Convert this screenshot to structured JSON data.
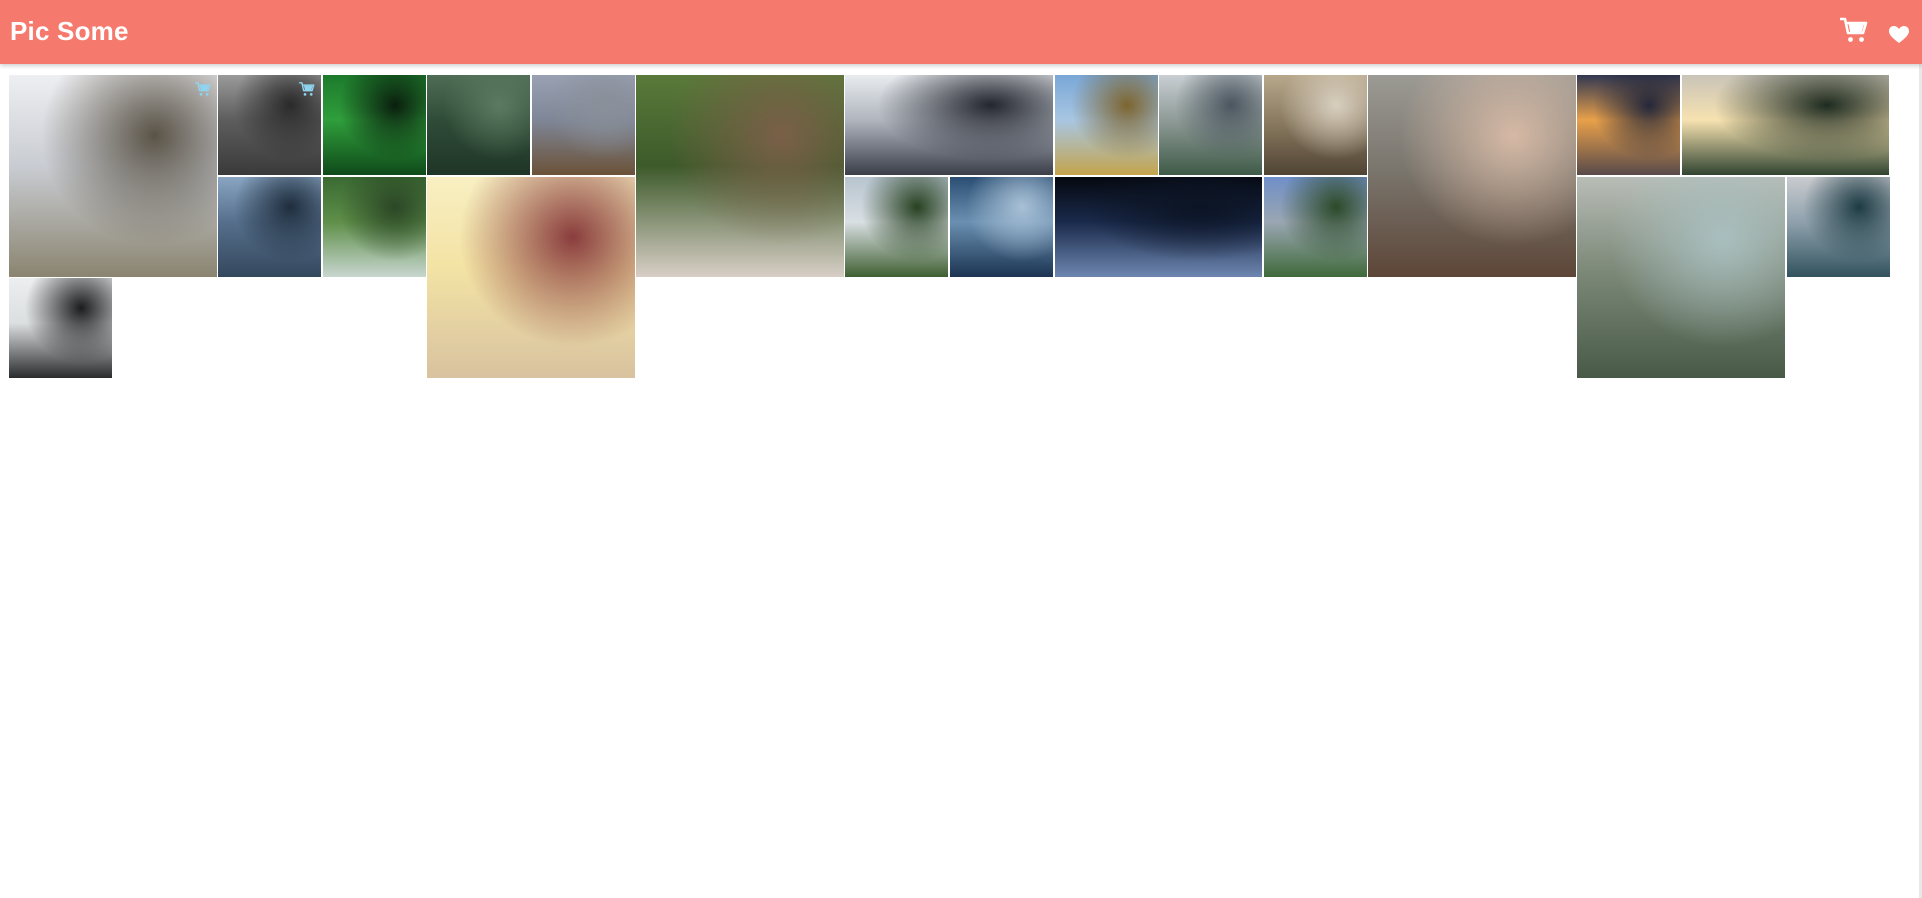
{
  "app": {
    "title": "Pic Some"
  },
  "header": {
    "icons": [
      {
        "name": "cart-icon",
        "color": "#ffffff"
      },
      {
        "name": "heart-icon",
        "color": "#ffffff"
      }
    ]
  },
  "colors": {
    "header_bg": "#f5796d",
    "accent_icon": "#8fd3ee",
    "page_bg": "#ffffff"
  },
  "photos": [
    {
      "id": "bear",
      "colors": [
        "#eeeff2",
        "#c9ccd2",
        "#8a8470",
        "#5a5347"
      ],
      "hover_icon": "cart-icon"
    },
    {
      "id": "foggy-forest",
      "colors": [
        "#9a9a9a",
        "#5d5d5d",
        "#3a3a3a",
        "#2a2a2a"
      ],
      "hover_icon": "cart-icon"
    },
    {
      "id": "aurora",
      "colors": [
        "#1d7a2c",
        "#2f9e3b",
        "#0f4a1a",
        "#0a1f0e"
      ]
    },
    {
      "id": "grass-figure",
      "colors": [
        "#4f6d55",
        "#2f4c38",
        "#1f3527",
        "#5b7a60"
      ]
    },
    {
      "id": "eagle",
      "colors": [
        "#9aa1b3",
        "#7e8697",
        "#6b5238",
        "#8a9099"
      ]
    },
    {
      "id": "pug-blanket",
      "colors": [
        "#5a7a3a",
        "#3d5a2a",
        "#d8cfc7",
        "#7a5f48"
      ]
    },
    {
      "id": "skyscraper",
      "colors": [
        "#e8ecef",
        "#b0b5be",
        "#3a3e49",
        "#23262f"
      ]
    },
    {
      "id": "feet-field",
      "colors": [
        "#79a7d7",
        "#a8c6e2",
        "#c4a44c",
        "#7d6530"
      ]
    },
    {
      "id": "city-park",
      "colors": [
        "#c9cfd3",
        "#8f9b97",
        "#3e5a47",
        "#4b5660"
      ]
    },
    {
      "id": "desert-trees",
      "colors": [
        "#b7a78b",
        "#8c7c62",
        "#4f4333",
        "#d8cfbf"
      ]
    },
    {
      "id": "woman-portrait",
      "colors": [
        "#9c9a94",
        "#7b776f",
        "#5d4638",
        "#d6b9a5"
      ]
    },
    {
      "id": "highway-sunset",
      "colors": [
        "#313852",
        "#e8a04a",
        "#584a4a",
        "#25283a"
      ]
    },
    {
      "id": "pine-sun",
      "colors": [
        "#c9c4b8",
        "#f6e2b0",
        "#314431",
        "#1e2b20"
      ]
    },
    {
      "id": "seascape",
      "colors": [
        "#89a5c2",
        "#566f8c",
        "#34485d",
        "#1f2e3e"
      ]
    },
    {
      "id": "waterfall",
      "colors": [
        "#3a6a32",
        "#5f8f49",
        "#c8d6d0",
        "#2b4726"
      ]
    },
    {
      "id": "dreamcatcher",
      "colors": [
        "#f8efc2",
        "#f3e3a4",
        "#d8c2a0",
        "#8a3d3d"
      ]
    },
    {
      "id": "castle",
      "colors": [
        "#b7c4cf",
        "#d9dfe3",
        "#3f5f31",
        "#274121"
      ]
    },
    {
      "id": "wave",
      "colors": [
        "#2b4f73",
        "#6a8fb0",
        "#1b3452",
        "#a8c0d6"
      ]
    },
    {
      "id": "star-trails",
      "colors": [
        "#05080f",
        "#1a2a4b",
        "#6e87b0",
        "#0c1424"
      ]
    },
    {
      "id": "yosemite",
      "colors": [
        "#6f8fc8",
        "#9aa6b2",
        "#3f6a3a",
        "#2c4a29"
      ]
    },
    {
      "id": "river-valley",
      "colors": [
        "#b9bdb7",
        "#7e8a7a",
        "#485a47",
        "#a9bfbf"
      ]
    },
    {
      "id": "misty-mountain",
      "colors": [
        "#c9cbcf",
        "#8fa1ad",
        "#31535e",
        "#1d3b44"
      ]
    },
    {
      "id": "sea-stack",
      "colors": [
        "#eceeef",
        "#dcdfe0",
        "#2a2b2c",
        "#1b1c1d"
      ]
    }
  ]
}
